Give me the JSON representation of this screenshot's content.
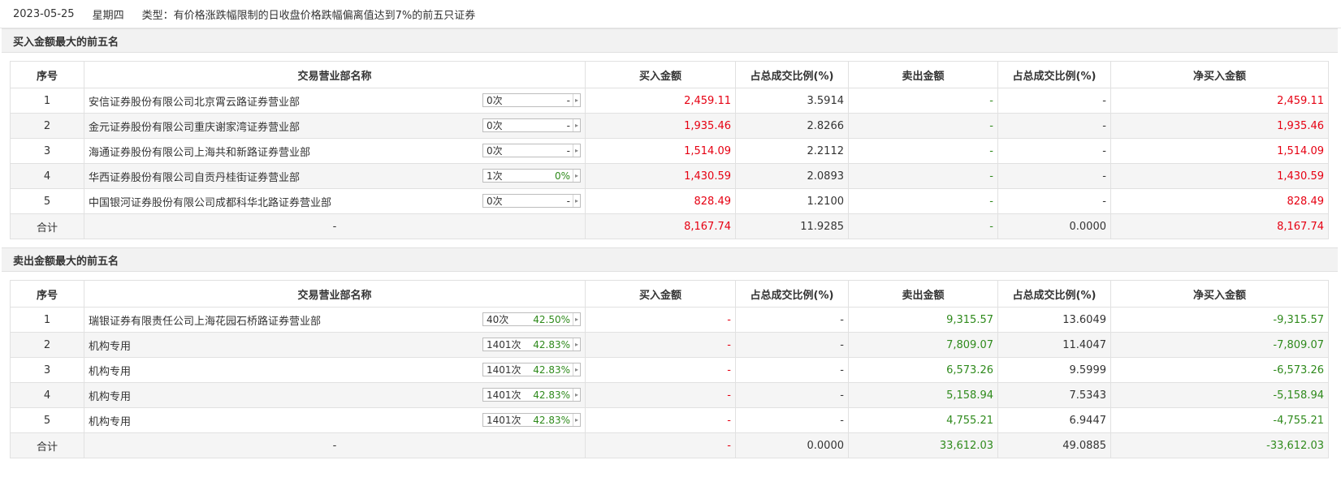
{
  "top": {
    "date": "2023-05-25",
    "weekday": "星期四",
    "type_text": "类型：有价格涨跌幅限制的日收盘价格跌幅偏离值达到7%的前五只证券"
  },
  "columns": [
    "序号",
    "交易营业部名称",
    "买入金额",
    "占总成交比例(%)",
    "卖出金额",
    "占总成交比例(%)",
    "净买入金额"
  ],
  "buy_section": {
    "title": "买入金额最大的前五名",
    "rows": [
      {
        "idx": "1",
        "name": "安信证券股份有限公司北京霄云路证券营业部",
        "times": "0次",
        "rate": "-",
        "buy": "2,459.11",
        "buy_pct": "3.5914",
        "sell": "-",
        "sell_pct": "-",
        "net": "2,459.11"
      },
      {
        "idx": "2",
        "name": "金元证券股份有限公司重庆谢家湾证券营业部",
        "times": "0次",
        "rate": "-",
        "buy": "1,935.46",
        "buy_pct": "2.8266",
        "sell": "-",
        "sell_pct": "-",
        "net": "1,935.46"
      },
      {
        "idx": "3",
        "name": "海通证券股份有限公司上海共和新路证券营业部",
        "times": "0次",
        "rate": "-",
        "buy": "1,514.09",
        "buy_pct": "2.2112",
        "sell": "-",
        "sell_pct": "-",
        "net": "1,514.09"
      },
      {
        "idx": "4",
        "name": "华西证券股份有限公司自贡丹桂街证券营业部",
        "times": "1次",
        "rate": "0%",
        "buy": "1,430.59",
        "buy_pct": "2.0893",
        "sell": "-",
        "sell_pct": "-",
        "net": "1,430.59"
      },
      {
        "idx": "5",
        "name": "中国银河证券股份有限公司成都科华北路证券营业部",
        "times": "0次",
        "rate": "-",
        "buy": "828.49",
        "buy_pct": "1.2100",
        "sell": "-",
        "sell_pct": "-",
        "net": "828.49"
      }
    ],
    "total": {
      "label": "合计",
      "name": "-",
      "buy": "8,167.74",
      "buy_pct": "11.9285",
      "sell": "-",
      "sell_pct": "0.0000",
      "net": "8,167.74"
    }
  },
  "sell_section": {
    "title": "卖出金额最大的前五名",
    "rows": [
      {
        "idx": "1",
        "name": "瑞银证券有限责任公司上海花园石桥路证券营业部",
        "times": "40次",
        "rate": "42.50%",
        "buy": "-",
        "buy_pct": "-",
        "sell": "9,315.57",
        "sell_pct": "13.6049",
        "net": "-9,315.57"
      },
      {
        "idx": "2",
        "name": "机构专用",
        "times": "1401次",
        "rate": "42.83%",
        "buy": "-",
        "buy_pct": "-",
        "sell": "7,809.07",
        "sell_pct": "11.4047",
        "net": "-7,809.07"
      },
      {
        "idx": "3",
        "name": "机构专用",
        "times": "1401次",
        "rate": "42.83%",
        "buy": "-",
        "buy_pct": "-",
        "sell": "6,573.26",
        "sell_pct": "9.5999",
        "net": "-6,573.26"
      },
      {
        "idx": "4",
        "name": "机构专用",
        "times": "1401次",
        "rate": "42.83%",
        "buy": "-",
        "buy_pct": "-",
        "sell": "5,158.94",
        "sell_pct": "7.5343",
        "net": "-5,158.94"
      },
      {
        "idx": "5",
        "name": "机构专用",
        "times": "1401次",
        "rate": "42.83%",
        "buy": "-",
        "buy_pct": "-",
        "sell": "4,755.21",
        "sell_pct": "6.9447",
        "net": "-4,755.21"
      }
    ],
    "total": {
      "label": "合计",
      "name": "-",
      "buy": "-",
      "buy_pct": "0.0000",
      "sell": "33,612.03",
      "sell_pct": "49.0885",
      "net": "-33,612.03"
    }
  },
  "colors": {
    "up": "#e60012",
    "down": "#2f8a1c",
    "header_bg": "#f2f2f2",
    "alt_row": "#f5f5f5",
    "border": "#e1e1e1"
  },
  "icons": {
    "pill_arrow": "caret-right-icon"
  }
}
